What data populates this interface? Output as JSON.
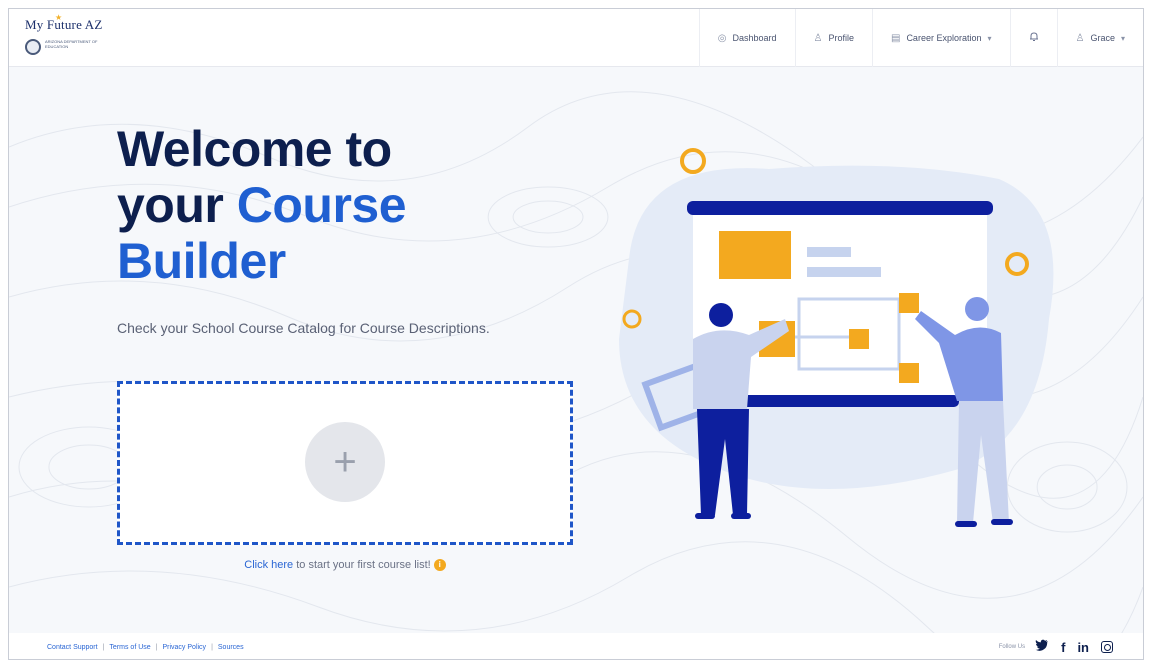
{
  "brand": {
    "name": "My Future AZ",
    "subtitle": "ARIZONA DEPARTMENT OF EDUCATION"
  },
  "nav": {
    "items": [
      {
        "label": "Dashboard",
        "icon": "dashboard-icon"
      },
      {
        "label": "Profile",
        "icon": "profile-icon"
      },
      {
        "label": "Career Exploration",
        "icon": "career-icon",
        "dropdown": true
      },
      {
        "label": "",
        "icon": "bell-icon"
      },
      {
        "label": "Grace",
        "icon": "user-icon",
        "dropdown": true
      }
    ]
  },
  "hero": {
    "title_line1": "Welcome to",
    "title_line2_a": "your ",
    "title_line2_b": "Course",
    "title_line3": "Builder",
    "subtitle": "Check your School Course Catalog for Course Descriptions."
  },
  "dropzone": {
    "icon": "plus-icon",
    "link_text": "Click here",
    "rest_text": " to start your first course list!",
    "info_glyph": "i"
  },
  "footer": {
    "links": [
      "Contact Support",
      "Terms of Use",
      "Privacy Policy",
      "Sources"
    ],
    "follow_label": "Follow Us",
    "social": [
      "twitter-icon",
      "facebook-icon",
      "linkedin-icon",
      "instagram-icon"
    ]
  },
  "colors": {
    "navy": "#0d1f4e",
    "accent_blue": "#1f5fd1",
    "orange": "#f3a91f",
    "illustration_bg": "#e4ebf7"
  }
}
